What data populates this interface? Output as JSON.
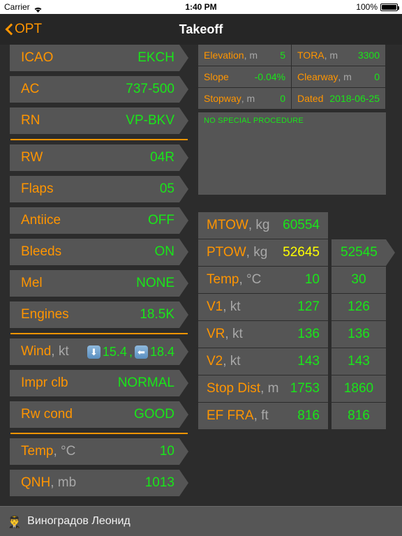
{
  "status_bar": {
    "carrier": "Carrier",
    "wifi_icon": "wifi-icon",
    "time": "1:40 PM",
    "battery_percent": "100%",
    "battery_icon": "battery-full-icon"
  },
  "nav": {
    "back_icon": "chevron-left-icon",
    "back_label": "OPT",
    "title": "Takeoff"
  },
  "left_panel": {
    "groups": [
      {
        "rows": [
          {
            "label": "ICAO",
            "unit": "",
            "value": "EKCH"
          },
          {
            "label": "AC",
            "unit": "",
            "value": "737-500"
          },
          {
            "label": "RN",
            "unit": "",
            "value": "VP-BKV"
          }
        ]
      },
      {
        "rows": [
          {
            "label": "RW",
            "unit": "",
            "value": "04R"
          },
          {
            "label": "Flaps",
            "unit": "",
            "value": "05"
          },
          {
            "label": "Antiice",
            "unit": "",
            "value": "OFF"
          },
          {
            "label": "Bleeds",
            "unit": "",
            "value": "ON"
          },
          {
            "label": "Mel",
            "unit": "",
            "value": "NONE"
          },
          {
            "label": "Engines",
            "unit": "",
            "value": "18.5K"
          }
        ]
      },
      {
        "rows": [
          {
            "label": "Wind",
            "unit": ", kt",
            "value": "",
            "wind": {
              "down_icon": "arrow-down-icon",
              "headwind": "15.4",
              "separator": ",",
              "left_icon": "arrow-left-icon",
              "crosswind": "18.4"
            }
          },
          {
            "label": "Impr clb",
            "unit": "",
            "value": "NORMAL"
          },
          {
            "label": "Rw cond",
            "unit": "",
            "value": "GOOD"
          }
        ]
      },
      {
        "rows": [
          {
            "label": "Temp",
            "unit": ", °C",
            "value": "10"
          },
          {
            "label": "QNH",
            "unit": ", mb",
            "value": "1013"
          }
        ]
      }
    ]
  },
  "right_panel": {
    "info": [
      {
        "label": "Elevation",
        "unit": ", m",
        "value": "5"
      },
      {
        "label": "TORA",
        "unit": ", m",
        "value": "3300"
      },
      {
        "label": "Slope",
        "unit": "",
        "value": "-0.04%"
      },
      {
        "label": "Clearway",
        "unit": ", m",
        "value": "0"
      },
      {
        "label": "Stopway",
        "unit": ", m",
        "value": "0"
      },
      {
        "label": "Dated",
        "unit": "",
        "value": "2018-06-25"
      }
    ],
    "procedure_text": "NO SPECIAL PROCEDURE",
    "results": [
      {
        "label": "MTOW",
        "unit": ", kg",
        "value": "60554",
        "alt": "",
        "alt_style": "none",
        "value_style": "green"
      },
      {
        "label": "PTOW",
        "unit": ", kg",
        "value": "52645",
        "alt": "52545",
        "alt_style": "arrow",
        "value_style": "yellow"
      },
      {
        "label": "Temp",
        "unit": ", °C",
        "value": "10",
        "alt": "30",
        "alt_style": "plain",
        "value_style": "green"
      },
      {
        "label": "V1",
        "unit": ", kt",
        "value": "127",
        "alt": "126",
        "alt_style": "plain",
        "value_style": "green"
      },
      {
        "label": "VR",
        "unit": ", kt",
        "value": "136",
        "alt": "136",
        "alt_style": "plain",
        "value_style": "green"
      },
      {
        "label": "V2",
        "unit": ", kt",
        "value": "143",
        "alt": "143",
        "alt_style": "plain",
        "value_style": "green"
      },
      {
        "label": "Stop Dist",
        "unit": ", m",
        "value": "1753",
        "alt": "1860",
        "alt_style": "plain",
        "value_style": "green"
      },
      {
        "label": "EF FRA",
        "unit": ", ft",
        "value": "816",
        "alt": "816",
        "alt_style": "plain",
        "value_style": "green"
      }
    ]
  },
  "bottom_bar": {
    "pilot_icon": "pilot-avatar-icon",
    "user_name": "Виноградов Леонид"
  },
  "colors": {
    "label_orange": "#ff9500",
    "value_green": "#19e619",
    "value_yellow": "#ffff00",
    "unit_gray": "#a8a8a8",
    "row_bg": "#555555",
    "page_bg": "#2c2c2c"
  }
}
